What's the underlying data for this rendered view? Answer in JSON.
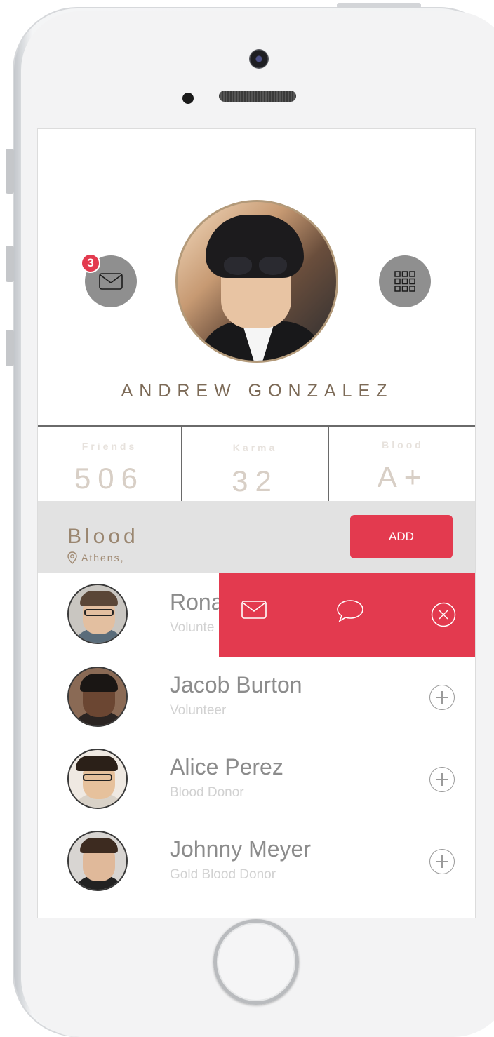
{
  "profile": {
    "name": "ANDREW GONZALEZ",
    "message_badge": "3"
  },
  "stats": [
    {
      "label": "Friends",
      "value": "506"
    },
    {
      "label": "Karma",
      "value": "32"
    },
    {
      "label": "Blood",
      "value": "A+"
    }
  ],
  "blood_section": {
    "title": "Blood",
    "location": "Athens,",
    "add_label": "ADD"
  },
  "people": [
    {
      "name": "Rona",
      "role": "Volunte"
    },
    {
      "name": "Jacob Burton",
      "role": "Volunteer"
    },
    {
      "name": "Alice Perez",
      "role": "Blood Donor"
    },
    {
      "name": "Johnny Meyer",
      "role": "Gold Blood Donor"
    }
  ],
  "colors": {
    "accent": "#e33a4f",
    "name_text": "#7c6a57",
    "button_gray": "#8f8f8f"
  },
  "icons": {
    "message": "envelope-icon",
    "menu": "grid-icon",
    "location": "map-pin-icon",
    "chat": "speech-bubble-icon",
    "close": "close-circle-icon",
    "add": "plus-circle-icon"
  }
}
